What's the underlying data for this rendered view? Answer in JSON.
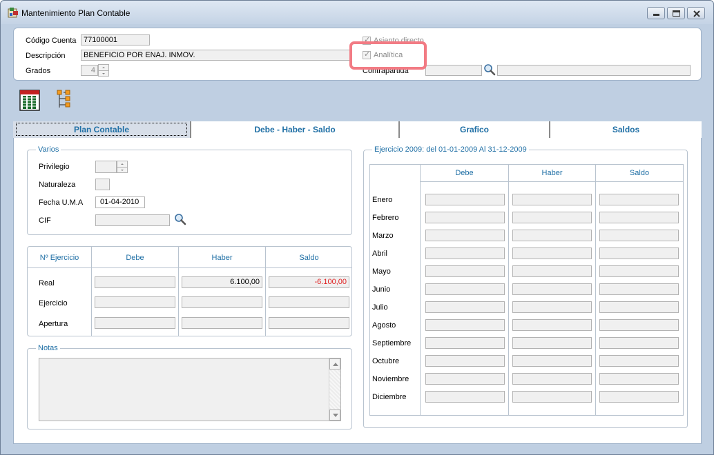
{
  "window": {
    "title": "Mantenimiento Plan Contable"
  },
  "header": {
    "codigo_label": "Código Cuenta",
    "codigo_value": "77100001",
    "descripcion_label": "Descripción",
    "descripcion_value": "BENEFICIO POR ENAJ. INMOV.",
    "grados_label": "Grados",
    "grados_value": "4",
    "asiento_label": "Asiento directo",
    "asiento_checked": true,
    "analitica_label": "Analítica",
    "analitica_checked": true,
    "contrapartida_label": "Contrapartida",
    "contrapartida_code": "",
    "contrapartida_desc": ""
  },
  "toolbar": {
    "icons": [
      "columns-view-icon",
      "tree-view-icon"
    ]
  },
  "tabs": [
    {
      "label": "Plan Contable",
      "active": true
    },
    {
      "label": "Debe  -  Haber  -  Saldo",
      "active": false
    },
    {
      "label": "Grafico",
      "active": false
    },
    {
      "label": "Saldos",
      "active": false
    }
  ],
  "varios": {
    "title": "Varios",
    "privilegio_label": "Privilegio",
    "privilegio_value": "",
    "naturaleza_label": "Naturaleza",
    "naturaleza_value": "",
    "fecha_label": "Fecha U.M.A",
    "fecha_value": "01-04-2010",
    "cif_label": "CIF",
    "cif_value": ""
  },
  "ejercicio_table": {
    "header_first": "Nº Ejercicio",
    "columns": [
      "Debe",
      "Haber",
      "Saldo"
    ],
    "rows": [
      {
        "label": "Real",
        "debe": "",
        "haber": "6.100,00",
        "saldo": "-6.100,00"
      },
      {
        "label": "Ejercicio",
        "debe": "",
        "haber": "",
        "saldo": ""
      },
      {
        "label": "Apertura",
        "debe": "",
        "haber": "",
        "saldo": ""
      }
    ]
  },
  "notas": {
    "title": "Notas",
    "value": ""
  },
  "monthly": {
    "title": "Ejercicio 2009: del 01-01-2009 Al 31-12-2009",
    "columns": [
      "Debe",
      "Haber",
      "Saldo"
    ],
    "months": [
      "Enero",
      "Febrero",
      "Marzo",
      "Abril",
      "Mayo",
      "Junio",
      "Julio",
      "Agosto",
      "Septiembre",
      "Octubre",
      "Noviembre",
      "Diciembre"
    ]
  },
  "colors": {
    "accent_text": "#1f6fa5",
    "negative": "#e02020",
    "highlight": "#f27b84"
  }
}
